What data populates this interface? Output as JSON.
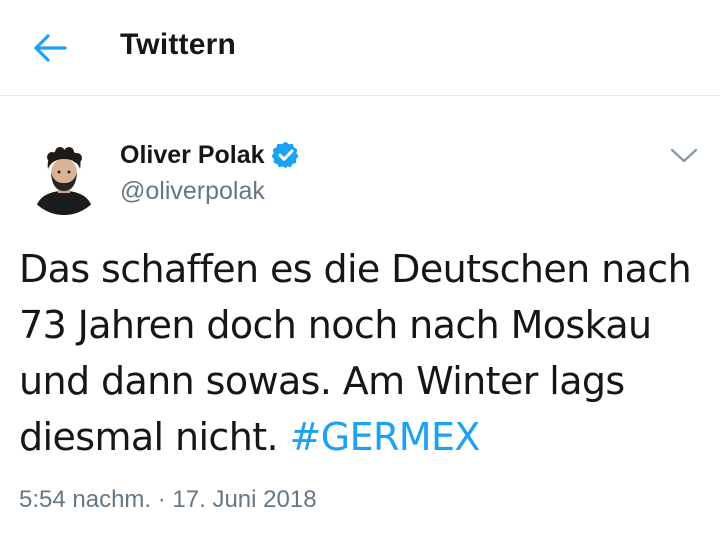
{
  "header": {
    "back_icon": "arrow-left-icon",
    "title": "Twittern"
  },
  "author": {
    "name": "Oliver Polak",
    "handle": "@oliverpolak",
    "verified_icon": "verified-badge-icon",
    "avatar_icon": "avatar"
  },
  "menu": {
    "icon": "chevron-down-icon"
  },
  "tweet": {
    "lines": [
      "Das schaffen es die Deutschen nach",
      "73 Jahren doch noch nach Moskau",
      "und dann sowas. Am Winter lags",
      "diesmal nicht. "
    ],
    "hashtag": "#GERMEX"
  },
  "meta": {
    "time": "5:54 nachm.",
    "separator": " · ",
    "date": "17. Juni 2018"
  },
  "colors": {
    "accent": "#1da1f2",
    "text": "#14171a",
    "muted": "#657786",
    "divider": "#e1e8ed"
  }
}
